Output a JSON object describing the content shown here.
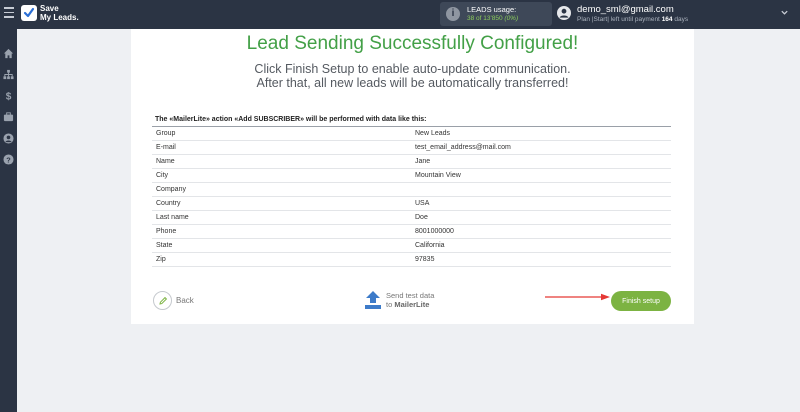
{
  "app": {
    "logo_line1": "Save",
    "logo_line2": "My Leads."
  },
  "usage": {
    "label": "LEADS usage:",
    "used": "38",
    "of_text": "of 13'850",
    "percent": "(0%)"
  },
  "account": {
    "email": "demo_sml@gmail.com",
    "plan_prefix": "Plan |Start| left until payment",
    "days_count": "164",
    "days_suffix": "days"
  },
  "sidebar": {
    "icons": [
      "home-icon",
      "sitemap-icon",
      "dollar-icon",
      "briefcase-icon",
      "user-icon",
      "help-icon"
    ]
  },
  "main": {
    "title": "Lead Sending Successfully Configured!",
    "subtitle_line1": "Click Finish Setup to enable auto-update communication.",
    "subtitle_line2": "After that, all new leads will be automatically transferred!",
    "table_title": "The «MailerLite» action «Add SUBSCRIBER» will be performed with data like this:",
    "rows": [
      {
        "label": "Group",
        "value": "New Leads"
      },
      {
        "label": "E-mail",
        "value": "test_email_address@mail.com"
      },
      {
        "label": "Name",
        "value": "Jane"
      },
      {
        "label": "City",
        "value": "Mountain View"
      },
      {
        "label": "Company",
        "value": ""
      },
      {
        "label": "Country",
        "value": "USA"
      },
      {
        "label": "Last name",
        "value": "Doe"
      },
      {
        "label": "Phone",
        "value": "8001000000"
      },
      {
        "label": "State",
        "value": "California"
      },
      {
        "label": "Zip",
        "value": "97835"
      }
    ],
    "back_label": "Back",
    "send_line1": "Send test data",
    "send_line2_prefix": "to",
    "send_line2_service": "MailerLite",
    "finish_label": "Finish setup"
  },
  "colors": {
    "topbar": "#2b3444",
    "accent_green": "#43a047",
    "button_green": "#7cb342",
    "annotation_red": "#e53935"
  }
}
